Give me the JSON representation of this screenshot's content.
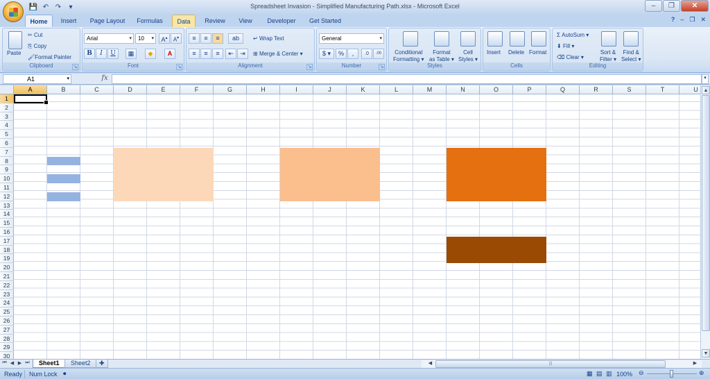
{
  "window": {
    "title": "Spreadsheet Invasion - Simplified Manufacturing Path.xlsx - Microsoft Excel"
  },
  "tabs": [
    "Home",
    "Insert",
    "Page Layout",
    "Formulas",
    "Data",
    "Review",
    "View",
    "Developer",
    "Get Started"
  ],
  "active_tab": "Home",
  "ribbon": {
    "clipboard": {
      "title": "Clipboard",
      "paste": "Paste",
      "cut": "Cut",
      "copy": "Copy",
      "format_painter": "Format Painter"
    },
    "font": {
      "title": "Font",
      "name": "Arial",
      "size": "10",
      "bold": "B",
      "italic": "I",
      "underline": "U",
      "grow": "A",
      "shrink": "A"
    },
    "alignment": {
      "title": "Alignment",
      "wrap": "Wrap Text",
      "merge": "Merge & Center"
    },
    "number": {
      "title": "Number",
      "format": "General",
      "currency": "$",
      "percent": "%",
      "comma": ",",
      "inc": ".0",
      "dec": ".00"
    },
    "styles": {
      "title": "Styles",
      "conditional": "Conditional",
      "conditional2": "Formatting",
      "format_table": "Format",
      "format_table2": "as Table",
      "cell_styles": "Cell",
      "cell_styles2": "Styles"
    },
    "cells": {
      "title": "Cells",
      "insert": "Insert",
      "delete": "Delete",
      "format": "Format"
    },
    "editing": {
      "title": "Editing",
      "autosum": "AutoSum",
      "fill": "Fill",
      "clear": "Clear",
      "sort": "Sort &",
      "sort2": "Filter",
      "find": "Find &",
      "find2": "Select"
    }
  },
  "formula_bar": {
    "name_box": "A1",
    "fx": "fx",
    "value": ""
  },
  "columns": [
    "A",
    "B",
    "C",
    "D",
    "E",
    "F",
    "G",
    "H",
    "I",
    "J",
    "K",
    "L",
    "M",
    "N",
    "O",
    "P",
    "Q",
    "R",
    "S",
    "T",
    "U"
  ],
  "selected_column": "A",
  "selected_row": 1,
  "row_count": 30,
  "colored_blocks": [
    {
      "name": "blue-bar-row-8",
      "color": "#95b3e0",
      "col_start": "B",
      "col_end": "B",
      "row_start": 8,
      "row_end": 8
    },
    {
      "name": "blue-bar-row-10",
      "color": "#95b3e0",
      "col_start": "B",
      "col_end": "B",
      "row_start": 10,
      "row_end": 10
    },
    {
      "name": "blue-bar-row-12",
      "color": "#95b3e0",
      "col_start": "B",
      "col_end": "B",
      "row_start": 12,
      "row_end": 12
    },
    {
      "name": "light-peach-block",
      "color": "#fcd8b9",
      "col_start": "D",
      "col_end": "F",
      "row_start": 7,
      "row_end": 12
    },
    {
      "name": "light-orange-block",
      "color": "#fbbe8d",
      "col_start": "I",
      "col_end": "K",
      "row_start": 7,
      "row_end": 12
    },
    {
      "name": "orange-block",
      "color": "#e5700f",
      "col_start": "N",
      "col_end": "P",
      "row_start": 7,
      "row_end": 12
    },
    {
      "name": "brown-block",
      "color": "#9a4a03",
      "col_start": "N",
      "col_end": "P",
      "row_start": 17,
      "row_end": 19
    }
  ],
  "sheets": [
    "Sheet1",
    "Sheet2"
  ],
  "active_sheet": "Sheet1",
  "status": {
    "ready": "Ready",
    "num_lock": "Num Lock",
    "zoom": "100%"
  }
}
